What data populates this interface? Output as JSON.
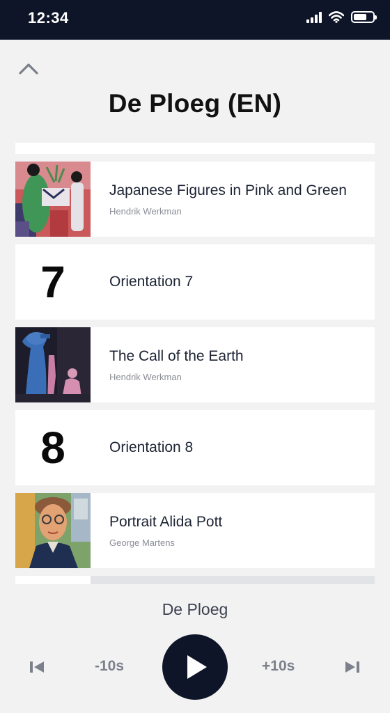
{
  "status_bar": {
    "time": "12:34",
    "icons": [
      "signal-icon",
      "wifi-icon",
      "battery-icon"
    ]
  },
  "header": {
    "collapse_icon": "chevron-up-icon",
    "title": "De Ploeg (EN)"
  },
  "list": {
    "items": [
      {
        "type": "artwork",
        "title": "Japanese Figures in Pink and Green",
        "artist": "Hendrik Werkman"
      },
      {
        "type": "orientation",
        "number": "7",
        "title": "Orientation 7"
      },
      {
        "type": "artwork",
        "title": "The Call of the Earth",
        "artist": "Hendrik Werkman"
      },
      {
        "type": "orientation",
        "number": "8",
        "title": "Orientation 8"
      },
      {
        "type": "artwork",
        "title": "Portrait Alida Pott",
        "artist": "George Martens"
      }
    ]
  },
  "player": {
    "title": "De Ploeg",
    "rewind_label": "-10s",
    "forward_label": "+10s",
    "icons": [
      "skip-previous-icon",
      "play-icon",
      "skip-next-icon"
    ]
  },
  "colors": {
    "navy": "#0e1528",
    "background": "#f2f2f3",
    "muted_text": "#7c808a"
  }
}
